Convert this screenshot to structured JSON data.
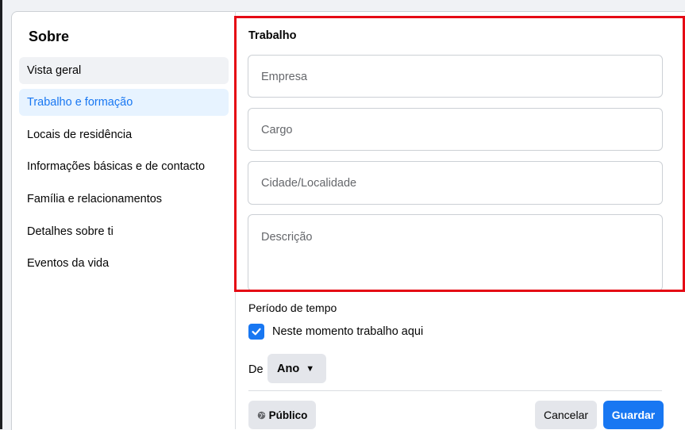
{
  "sidebar": {
    "title": "Sobre",
    "items": [
      {
        "label": "Vista geral"
      },
      {
        "label": "Trabalho e formação"
      },
      {
        "label": "Locais de residência"
      },
      {
        "label": "Informações básicas e de contacto"
      },
      {
        "label": "Família e relacionamentos"
      },
      {
        "label": "Detalhes sobre ti"
      },
      {
        "label": "Eventos da vida"
      }
    ]
  },
  "work": {
    "title": "Trabalho",
    "company_placeholder": "Empresa",
    "position_placeholder": "Cargo",
    "city_placeholder": "Cidade/Localidade",
    "description_placeholder": "Descrição"
  },
  "period": {
    "label": "Período de tempo",
    "current_job_label": "Neste momento trabalho aqui",
    "current_job_checked": true,
    "from_label": "De",
    "year_value": "Ano"
  },
  "footer": {
    "privacy_label": "Público",
    "privacy_icon": "globe-icon",
    "cancel_label": "Cancelar",
    "save_label": "Guardar"
  },
  "colors": {
    "accent": "#1877f2",
    "active_bg": "#e7f3ff",
    "highlight": "#e50914"
  }
}
